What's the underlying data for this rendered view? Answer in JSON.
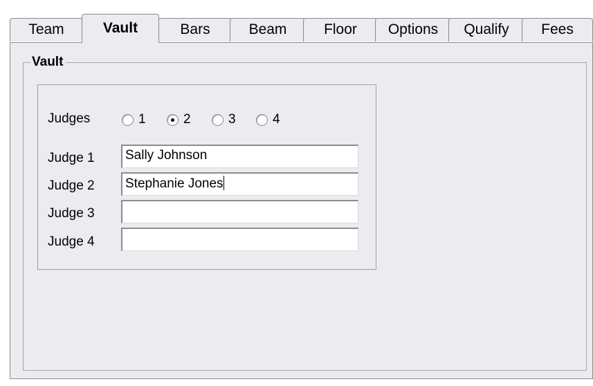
{
  "tabs": [
    {
      "label": "Team",
      "active": false
    },
    {
      "label": "Vault",
      "active": true
    },
    {
      "label": "Bars",
      "active": false
    },
    {
      "label": "Beam",
      "active": false
    },
    {
      "label": "Floor",
      "active": false
    },
    {
      "label": "Options",
      "active": false
    },
    {
      "label": "Qualify",
      "active": false
    },
    {
      "label": "Fees",
      "active": false
    }
  ],
  "group": {
    "title": "Vault"
  },
  "judges": {
    "label": "Judges",
    "options": [
      "1",
      "2",
      "3",
      "4"
    ],
    "selected": "2"
  },
  "judge_fields": [
    {
      "label": "Judge 1",
      "value": "Sally Johnson"
    },
    {
      "label": "Judge 2",
      "value": "Stephanie Jones"
    },
    {
      "label": "Judge 3",
      "value": ""
    },
    {
      "label": "Judge 4",
      "value": ""
    }
  ]
}
